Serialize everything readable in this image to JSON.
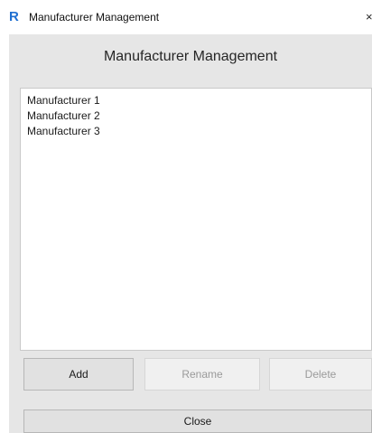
{
  "window": {
    "title": "Manufacturer Management",
    "app_icon": "R",
    "close_glyph": "×"
  },
  "main": {
    "heading": "Manufacturer Management",
    "manufacturers": [
      "Manufacturer 1",
      "Manufacturer 2",
      "Manufacturer 3"
    ]
  },
  "buttons": {
    "add": "Add",
    "rename": "Rename",
    "delete": "Delete",
    "close": "Close"
  },
  "colors": {
    "app_icon": "#1f6fd1",
    "client_background": "#e6e6e6",
    "disabled_text": "#9a9a9a"
  }
}
